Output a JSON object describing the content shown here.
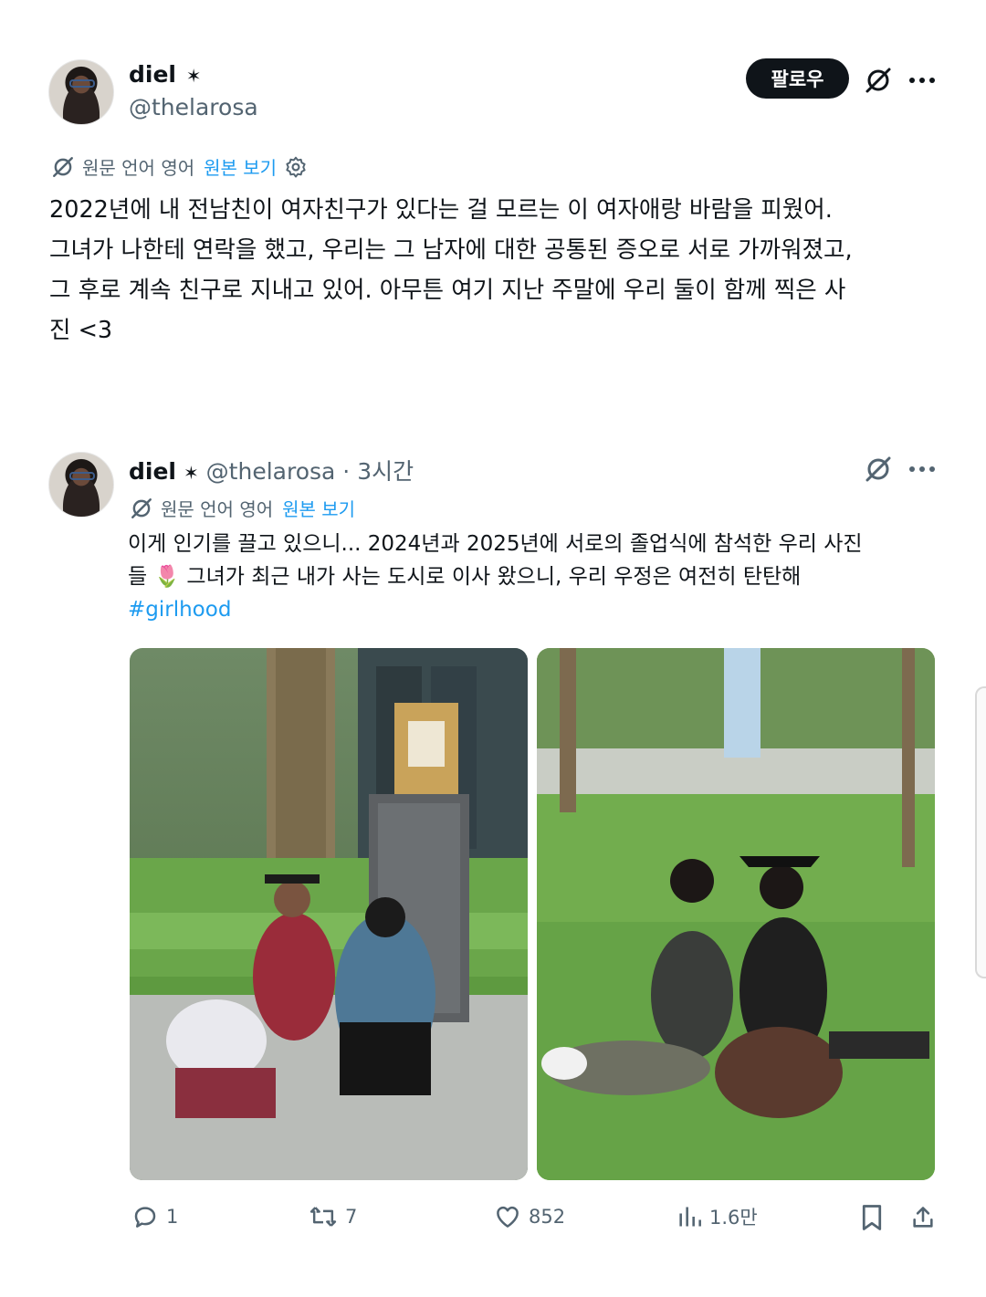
{
  "main_tweet": {
    "display_name": "diel",
    "badge": "✶",
    "handle": "@thelarosa",
    "follow_label": "팔로우",
    "translation": {
      "source_label": "원문 언어 영어",
      "show_original": "원본 보기"
    },
    "text": "2022년에 내 전남친이 여자친구가 있다는 걸 모르는 이 여자애랑 바람을 피웠어.\n그녀가 나한테 연락을 했고, 우리는 그 남자에 대한 공통된 증오로 서로 가까워졌고,\n그 후로 계속 친구로 지내고 있어. 아무튼 여기 지난 주말에 우리 둘이 함께 찍은 사\n진 <3"
  },
  "quoted_tweet": {
    "display_name": "diel",
    "badge": "✶",
    "handle": "@thelarosa",
    "separator": "·",
    "time": "3시간",
    "translation": {
      "source_label": "원문 언어 영어",
      "show_original": "원본 보기"
    },
    "text_line1": "이게 인기를 끌고 있으니... 2024년과 2025년에 서로의 졸업식에 참석한 우리 사진",
    "text_line2": "들 🌷 그녀가 최근 내가 사는 도시로 이사 왔으니, 우리 우정은 여전히 탄탄해",
    "hashtag": "#girlhood"
  },
  "actions": {
    "replies": "1",
    "reposts": "7",
    "likes": "852",
    "views": "1.6만"
  },
  "colors": {
    "text": "#0f1419",
    "secondary": "#536471",
    "link": "#1d9bf0",
    "button_bg": "#0f1419"
  }
}
